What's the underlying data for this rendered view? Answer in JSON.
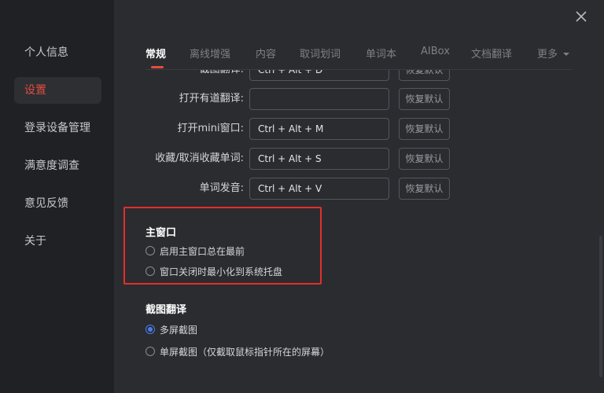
{
  "sidebar": {
    "items": [
      {
        "label": "个人信息"
      },
      {
        "label": "设置"
      },
      {
        "label": "登录设备管理"
      },
      {
        "label": "满意度调查"
      },
      {
        "label": "意见反馈"
      },
      {
        "label": "关于"
      }
    ],
    "active_index": 1
  },
  "tabs": [
    {
      "label": "常规"
    },
    {
      "label": "离线增强"
    },
    {
      "label": "内容"
    },
    {
      "label": "取词划词"
    },
    {
      "label": "单词本"
    },
    {
      "label": "AIBox"
    },
    {
      "label": "文档翻译"
    },
    {
      "label": "更多"
    }
  ],
  "shortcuts": [
    {
      "label": "截图翻译:",
      "value": "Ctrl + Alt + D",
      "reset": "恢复默认"
    },
    {
      "label": "打开有道翻译:",
      "value": "",
      "reset": "恢复默认"
    },
    {
      "label": "打开mini窗口:",
      "value": "Ctrl + Alt + M",
      "reset": "恢复默认"
    },
    {
      "label": "收藏/取消收藏单词:",
      "value": "Ctrl + Alt + S",
      "reset": "恢复默认"
    },
    {
      "label": "单词发音:",
      "value": "Ctrl + Alt + V",
      "reset": "恢复默认"
    }
  ],
  "main_window": {
    "title": "主窗口",
    "options": [
      {
        "label": "启用主窗口总在最前",
        "checked": false
      },
      {
        "label": "窗口关闭时最小化到系统托盘",
        "checked": false
      }
    ]
  },
  "screenshot_translate": {
    "title": "截图翻译",
    "options": [
      {
        "label": "多屏截图",
        "checked": true
      },
      {
        "label": "单屏截图（仅截取鼠标指针所在的屏幕）",
        "checked": false
      }
    ]
  },
  "colors": {
    "accent": "#e24c3f",
    "radio_on": "#4a7cf0",
    "highlight": "#e0302b"
  }
}
